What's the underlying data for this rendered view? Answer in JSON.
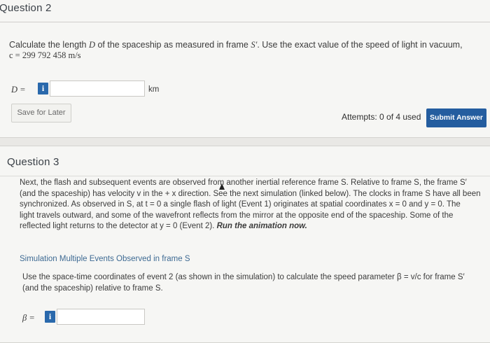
{
  "question2": {
    "title": "Question 2",
    "prompt_line1_pre": "Calculate the length ",
    "prompt_var_D": "D",
    "prompt_line1_mid": " of the spaceship as measured in frame ",
    "prompt_frame": "S′",
    "prompt_line1_post": ". Use the exact value of the speed of light in vacuum,",
    "c_expression": "c = 299 792 458 m/s",
    "answer_label": "D =",
    "info_glyph": "i",
    "answer_value": "",
    "unit": "km",
    "save_label": "Save for Later",
    "attempts_label": "Attempts: 0 of 4 used",
    "submit_label": "Submit Answer"
  },
  "question3": {
    "title": "Question 3",
    "p1": "Next, the flash and subsequent events are observed from another inertial reference frame S. Relative to frame S, the frame S′",
    "p2": "(and the spaceship) has velocity v in the + x direction. See the next simulation (linked below). The clocks in frame S have all been",
    "p3": "synchronized. As observed in S, at t = 0 a single flash of light (Event 1) originates at spatial coordinates x = 0 and y = 0. The",
    "p4": "light travels outward, and some of the wavefront reflects from the mirror at the opposite end of the spaceship. Some of the",
    "p5_pre": "reflected light returns to the detector at y = 0 (Event 2). ",
    "p5_bold": "Run the animation now.",
    "sim_link": "Simulation Multiple Events Observed in frame S",
    "q_line1": "Use the space-time coordinates of event 2 (as shown in the simulation) to calculate the speed parameter β = v/c for frame S′",
    "q_line2": "(and the spaceship) relative to frame S.",
    "answer_label": "β =",
    "info_glyph": "i",
    "answer_value": ""
  },
  "colors": {
    "accent": "#245d9f",
    "info_button": "#2a69ac",
    "link": "#3e6a93",
    "card_bg": "#f6f6f4",
    "page_bg": "#e9e8e5"
  },
  "icons": {
    "info": "info-icon",
    "cursor": "mouse-cursor-icon"
  }
}
